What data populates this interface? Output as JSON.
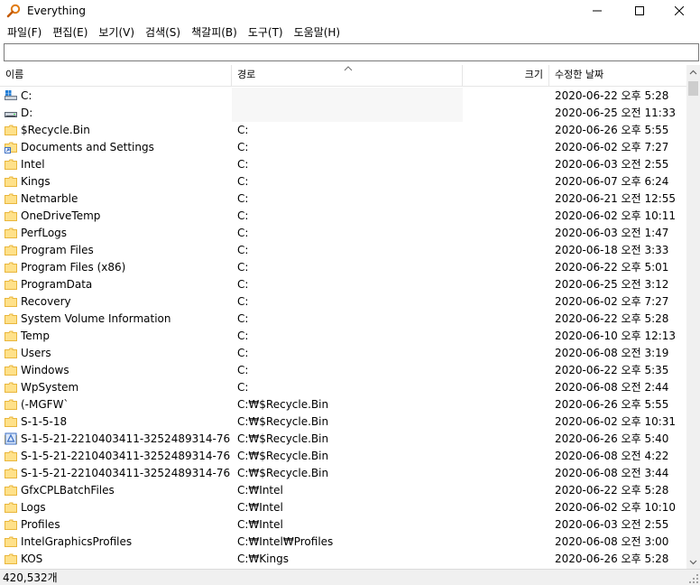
{
  "window": {
    "title": "Everything",
    "app_icon": "magnifier-icon",
    "buttons": [
      "minimize-icon",
      "maximize-icon",
      "close-icon"
    ]
  },
  "menu": [
    "파일(F)",
    "편집(E)",
    "보기(V)",
    "검색(S)",
    "책갈피(B)",
    "도구(T)",
    "도움말(H)"
  ],
  "search": {
    "value": "",
    "placeholder": ""
  },
  "columns": {
    "name": "이름",
    "path": "경로",
    "size": "크기",
    "modified": "수정한 날짜",
    "sort_indicator": "ascending"
  },
  "colors": {
    "folder": "#ffe18a",
    "folder_edge": "#e9b63c",
    "path_bg": "#f7f7f7",
    "drive": "#1e7bd6"
  },
  "rows": [
    {
      "icon": "system-drive-icon",
      "name": "C:",
      "path": "",
      "size": "",
      "date": "2020-06-22 오후 5:28"
    },
    {
      "icon": "drive-icon",
      "name": "D:",
      "path": "",
      "size": "",
      "date": "2020-06-25 오전 11:33"
    },
    {
      "icon": "folder-icon",
      "name": "$Recycle.Bin",
      "path": "C:",
      "size": "",
      "date": "2020-06-26 오후 5:55"
    },
    {
      "icon": "shortcut-folder-icon",
      "name": "Documents and Settings",
      "path": "C:",
      "size": "",
      "date": "2020-06-02 오후 7:27"
    },
    {
      "icon": "folder-icon",
      "name": "Intel",
      "path": "C:",
      "size": "",
      "date": "2020-06-03 오전 2:55"
    },
    {
      "icon": "folder-icon",
      "name": "Kings",
      "path": "C:",
      "size": "",
      "date": "2020-06-07 오후 6:24"
    },
    {
      "icon": "folder-icon",
      "name": "Netmarble",
      "path": "C:",
      "size": "",
      "date": "2020-06-21 오전 12:55"
    },
    {
      "icon": "folder-icon",
      "name": "OneDriveTemp",
      "path": "C:",
      "size": "",
      "date": "2020-06-02 오후 10:11"
    },
    {
      "icon": "folder-icon",
      "name": "PerfLogs",
      "path": "C:",
      "size": "",
      "date": "2020-06-03 오전 1:47"
    },
    {
      "icon": "folder-icon",
      "name": "Program Files",
      "path": "C:",
      "size": "",
      "date": "2020-06-18 오전 3:33"
    },
    {
      "icon": "folder-icon",
      "name": "Program Files (x86)",
      "path": "C:",
      "size": "",
      "date": "2020-06-22 오후 5:01"
    },
    {
      "icon": "folder-icon",
      "name": "ProgramData",
      "path": "C:",
      "size": "",
      "date": "2020-06-25 오전 3:12"
    },
    {
      "icon": "folder-icon",
      "name": "Recovery",
      "path": "C:",
      "size": "",
      "date": "2020-06-02 오후 7:27"
    },
    {
      "icon": "folder-icon",
      "name": "System Volume Information",
      "path": "C:",
      "size": "",
      "date": "2020-06-22 오후 5:28"
    },
    {
      "icon": "folder-icon",
      "name": "Temp",
      "path": "C:",
      "size": "",
      "date": "2020-06-10 오후 12:13"
    },
    {
      "icon": "folder-icon",
      "name": "Users",
      "path": "C:",
      "size": "",
      "date": "2020-06-08 오전 3:19"
    },
    {
      "icon": "folder-icon",
      "name": "Windows",
      "path": "C:",
      "size": "",
      "date": "2020-06-22 오후 5:35"
    },
    {
      "icon": "folder-icon",
      "name": "WpSystem",
      "path": "C:",
      "size": "",
      "date": "2020-06-08 오전 2:44"
    },
    {
      "icon": "folder-icon",
      "name": "(-MGFW`",
      "path": "C:₩$Recycle.Bin",
      "size": "",
      "date": "2020-06-26 오후 5:55"
    },
    {
      "icon": "folder-icon",
      "name": "S-1-5-18",
      "path": "C:₩$Recycle.Bin",
      "size": "",
      "date": "2020-06-02 오후 10:31"
    },
    {
      "icon": "recycle-bin-icon",
      "name": "S-1-5-21-2210403411-3252489314-76...",
      "path": "C:₩$Recycle.Bin",
      "size": "",
      "date": "2020-06-26 오후 5:40"
    },
    {
      "icon": "folder-icon",
      "name": "S-1-5-21-2210403411-3252489314-76...",
      "path": "C:₩$Recycle.Bin",
      "size": "",
      "date": "2020-06-08 오전 4:22"
    },
    {
      "icon": "folder-icon",
      "name": "S-1-5-21-2210403411-3252489314-76...",
      "path": "C:₩$Recycle.Bin",
      "size": "",
      "date": "2020-06-08 오전 3:44"
    },
    {
      "icon": "folder-icon",
      "name": "GfxCPLBatchFiles",
      "path": "C:₩Intel",
      "size": "",
      "date": "2020-06-22 오후 5:28"
    },
    {
      "icon": "folder-icon",
      "name": "Logs",
      "path": "C:₩Intel",
      "size": "",
      "date": "2020-06-02 오후 10:10"
    },
    {
      "icon": "folder-icon",
      "name": "Profiles",
      "path": "C:₩Intel",
      "size": "",
      "date": "2020-06-03 오전 2:55"
    },
    {
      "icon": "folder-icon",
      "name": "IntelGraphicsProfiles",
      "path": "C:₩Intel₩Profiles",
      "size": "",
      "date": "2020-06-08 오전 3:00"
    },
    {
      "icon": "folder-icon",
      "name": "KOS",
      "path": "C:₩Kings",
      "size": "",
      "date": "2020-06-26 오후 5:28"
    }
  ],
  "status": {
    "count": "420,532개"
  }
}
